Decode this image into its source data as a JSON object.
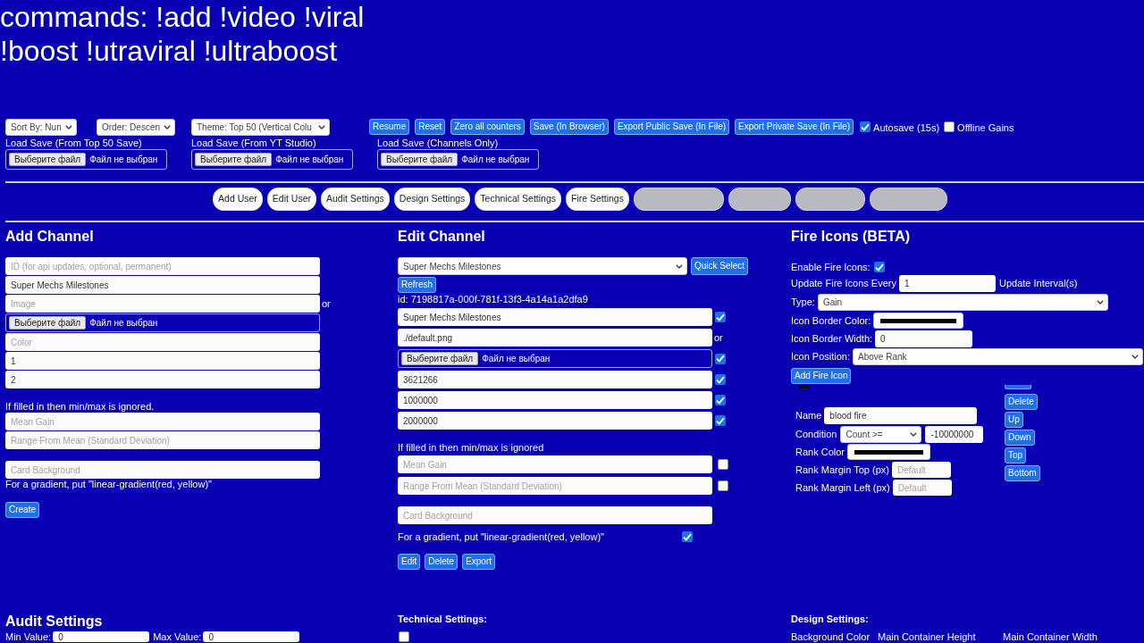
{
  "commands": [
    "commands: !add !video !viral",
    "!boost !utraviral !ultraboost"
  ],
  "toolbar": {
    "selects": [
      "Sort By: Nun",
      "Order: Descen",
      "Theme: Top 50 (Vertical Colu"
    ],
    "buttons": [
      "Resume",
      "Reset",
      "Zero all counters",
      "Save (In Browser)",
      "Export Public Save (In File)",
      "Export Private Save (In File)"
    ],
    "toggles": [
      {
        "label": "Autosave (15s)",
        "checked": true
      },
      {
        "label": "Offline Gains",
        "checked": false
      }
    ]
  },
  "load_saves": [
    {
      "label": "Load Save (From Top 50 Save)",
      "button": "Выберите файл",
      "status": "Файл не выбран"
    },
    {
      "label": "Load Save (From YT Studio)",
      "button": "Выберите файл",
      "status": "Файл не выбран"
    },
    {
      "label": "Load Save (Channels Only)",
      "button": "Выберите файл",
      "status": "Файл не выбран"
    }
  ],
  "tabs": [
    {
      "kind": "label",
      "label": "Add User"
    },
    {
      "kind": "label",
      "label": "Edit User"
    },
    {
      "kind": "label",
      "label": "Audit Settings"
    },
    {
      "kind": "label",
      "label": "Design Settings"
    },
    {
      "kind": "label",
      "label": "Technical Settings"
    },
    {
      "kind": "label",
      "label": "Fire Settings"
    },
    {
      "kind": "blurred"
    },
    {
      "kind": "blurred"
    },
    {
      "kind": "blurred"
    },
    {
      "kind": "blurred"
    }
  ],
  "add_channel": {
    "title": "Add Channel",
    "fields": [
      {
        "kind": "input",
        "placeholder": "ID (for api updates, optional, permanent)"
      },
      {
        "kind": "input",
        "value": "Super Mechs Milestones"
      },
      {
        "kind": "input",
        "placeholder": "Image",
        "side_text": "or"
      },
      {
        "kind": "file",
        "button": "Выберите файл",
        "status": "Файл не выбран"
      },
      {
        "kind": "input",
        "placeholder": "Color"
      },
      {
        "kind": "input",
        "value": "1"
      },
      {
        "kind": "input",
        "value": "2"
      }
    ],
    "note": "If filled in then min/max is ignored.",
    "stat_fields": [
      {
        "placeholder": "Mean Gain"
      },
      {
        "placeholder": "Range From Mean (Standard Deviation)"
      }
    ],
    "background_field": {
      "placeholder": "Card Background"
    },
    "hint": "For a gradient, put \"linear-gradient(red, yellow)\"",
    "button": "Create"
  },
  "edit_channel": {
    "title": "Edit Channel",
    "channel_select": "Super Mechs Milestones",
    "quick_select": "Quick Select",
    "refresh": "Refresh",
    "id": "id: 7198817a-000f-781f-13f3-4a14a1a2dfa9",
    "fields": [
      {
        "kind": "input",
        "value": "Super Mechs Milestones",
        "checked": true
      },
      {
        "kind": "input",
        "value": "./default.png",
        "side_text": "or"
      },
      {
        "kind": "file",
        "button": "Выберите файл",
        "status": "Файл не выбран",
        "checked": true
      },
      {
        "kind": "input",
        "value": "3621266",
        "checked": true
      },
      {
        "kind": "input",
        "value": "1000000",
        "checked": true
      },
      {
        "kind": "input",
        "value": "2000000",
        "checked": true
      }
    ],
    "note": "If filled in then min/max is ignored",
    "stat_fields": [
      {
        "placeholder": "Mean Gain",
        "checked": false
      },
      {
        "placeholder": "Range From Mean (Standard Deviation)",
        "checked": false
      }
    ],
    "background_field": {
      "placeholder": "Card Background"
    },
    "hint": "For a gradient, put \"linear-gradient(red, yellow)\"",
    "hint_checked": true,
    "buttons": [
      "Edit",
      "Delete",
      "Export"
    ]
  },
  "fire_icons": {
    "title": "Fire Icons (BETA)",
    "enable": {
      "label": "Enable Fire Icons:",
      "checked": true
    },
    "update": {
      "label": "Update Fire Icons Every",
      "value": "1",
      "suffix": "Update Interval(s)"
    },
    "type": {
      "label": "Type:",
      "value": "Gain"
    },
    "border_color": {
      "label": "Icon Border Color:",
      "color": "#000000"
    },
    "border_width": {
      "label": "Icon Border Width:",
      "value": "0"
    },
    "position": {
      "label": "Icon Position:",
      "value": "Above Rank"
    },
    "add_button": "Add Fire Icon",
    "icons": [
      {
        "name": {
          "label": "Name",
          "value": "blood fire"
        },
        "condition": {
          "label": "Condition",
          "value": "Count >=",
          "threshold": "-10000000"
        },
        "rank_color": {
          "label": "Rank Color",
          "color": "#000000"
        },
        "margin_top": {
          "label": "Rank Margin Top (px)",
          "placeholder": "Default"
        },
        "margin_left": {
          "label": "Rank Margin Left (px)",
          "placeholder": "Default"
        },
        "actions": [
          "Delete",
          "Up",
          "Down",
          "Top",
          "Bottom"
        ]
      }
    ]
  },
  "audit_settings": {
    "title": "Audit Settings",
    "fields": [
      {
        "label": "Min Value:",
        "value": "0"
      },
      {
        "label": "Max Value:",
        "value": "0"
      }
    ]
  },
  "technical_settings": {
    "title": "Technical Settings:",
    "toggles": [
      {
        "checked": false
      }
    ]
  },
  "design_settings": {
    "title": "Design Settings:",
    "labels": [
      "Background Color",
      "Main Container Height",
      "Main Container Width"
    ]
  }
}
